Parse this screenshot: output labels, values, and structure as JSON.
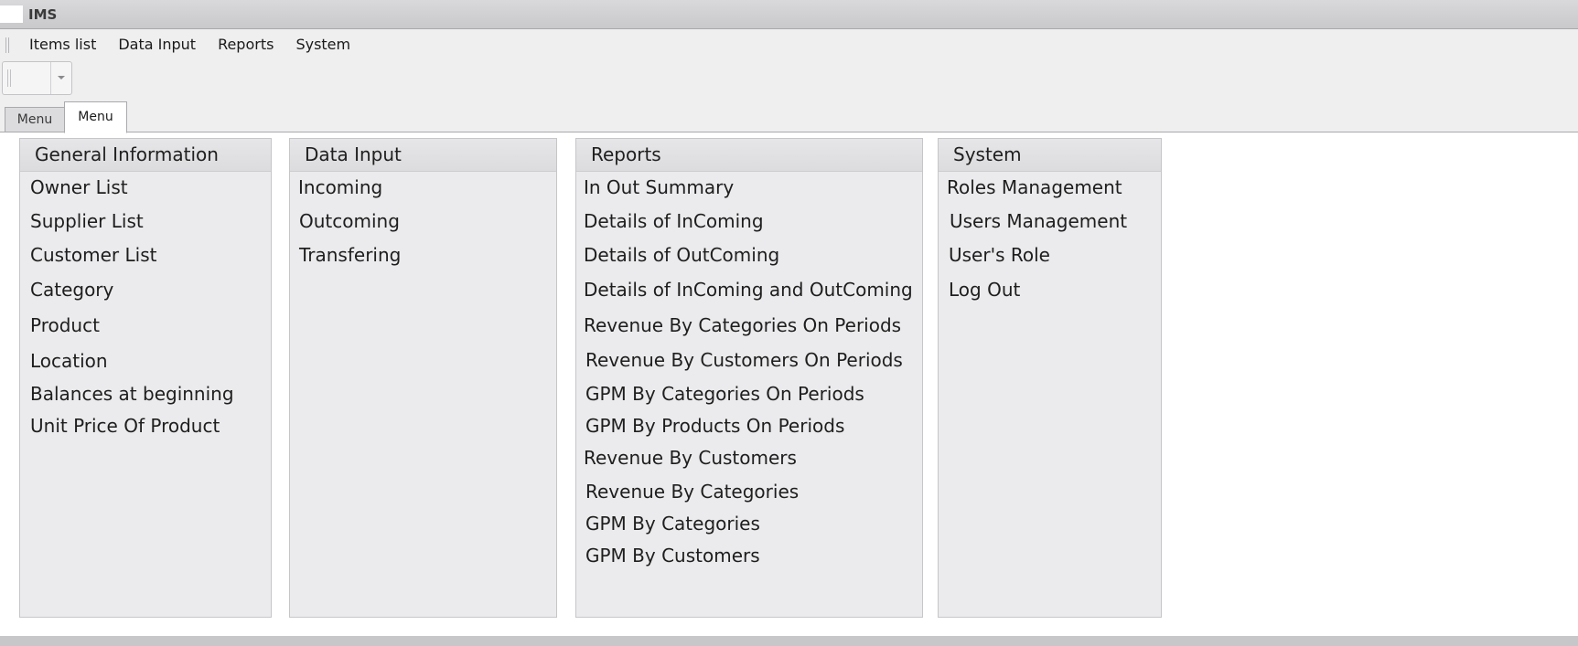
{
  "window": {
    "title": "IMS"
  },
  "menubar": {
    "items": [
      {
        "label": "Items list"
      },
      {
        "label": "Data Input"
      },
      {
        "label": "Reports"
      },
      {
        "label": "System"
      }
    ]
  },
  "tabs": [
    {
      "label": "Menu",
      "active": false
    },
    {
      "label": "Menu",
      "active": true
    }
  ],
  "groups": {
    "general": {
      "title": "General Information",
      "items": [
        "Owner List",
        "Supplier List",
        "Customer List",
        "Category",
        "Product",
        "Location",
        "Balances at beginning",
        "Unit Price Of Product"
      ]
    },
    "data_input": {
      "title": "Data Input",
      "items": [
        "Incoming",
        "Outcoming",
        "Transfering"
      ]
    },
    "reports": {
      "title": "Reports",
      "items": [
        "In Out Summary",
        "Details of InComing",
        "Details of OutComing",
        "Details of InComing and OutComing",
        "Revenue By Categories On Periods",
        "Revenue By Customers On Periods",
        "GPM By Categories On Periods",
        "GPM By Products On Periods",
        "Revenue By Customers",
        "Revenue By Categories",
        "GPM By Categories",
        "GPM By Customers"
      ]
    },
    "system": {
      "title": "System",
      "items": [
        "Roles Management",
        "Users Management",
        "User's Role",
        "Log Out"
      ]
    }
  },
  "colors": {
    "panel_bg": "#ebebed",
    "titlebar_bg": "#d9d9db",
    "border": "#c6c6c9"
  }
}
